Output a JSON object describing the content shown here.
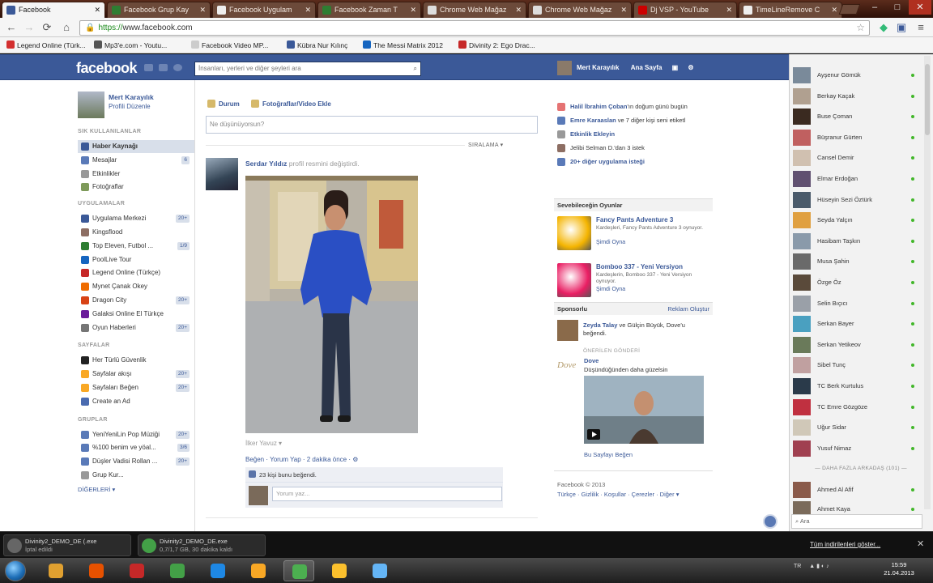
{
  "browser": {
    "tabs": [
      {
        "title": "Facebook",
        "active": true,
        "color": "#3b5998"
      },
      {
        "title": "Facebook Grup Kay",
        "color": "#2e7d32"
      },
      {
        "title": "Facebook Uygulam",
        "color": "#eeeeee"
      },
      {
        "title": "Facebook Zaman T",
        "color": "#2e7d32"
      },
      {
        "title": "Chrome Web Mağaz",
        "color": "#dddddd"
      },
      {
        "title": "Chrome Web Mağaz",
        "color": "#dddddd"
      },
      {
        "title": "Dj VSP - YouTube",
        "color": "#cc0000"
      },
      {
        "title": "TimeLineRemove C",
        "color": "#eeeeee"
      }
    ],
    "url_scheme": "https://",
    "url_host": "www.facebook.com",
    "bookmarks": [
      {
        "label": "Legend Online (Türk...",
        "color": "#d32f2f"
      },
      {
        "label": "Mp3'e.com - Youtu...",
        "color": "#555555"
      },
      {
        "label": "Facebook Video MP...",
        "color": "#cccccc"
      },
      {
        "label": "Kübra Nur Kılınç",
        "color": "#3b5998"
      },
      {
        "label": "The Messi Matrix 2012",
        "color": "#1565c0"
      },
      {
        "label": "Divinity 2: Ego Drac...",
        "color": "#c62828"
      }
    ]
  },
  "fb": {
    "logo": "facebook",
    "search_placeholder": "İnsanları, yerleri ve diğer şeyleri ara",
    "user_name": "Mert Karayılık",
    "home_label": "Ana Sayfa",
    "left": {
      "profile_name": "Mert Karayılık",
      "edit_profile": "Profili Düzenle",
      "favorites_header": "SIK KULLANILANLAR",
      "favorites": [
        {
          "label": "Haber Kaynağı",
          "selected": true,
          "color": "#3b5998"
        },
        {
          "label": "Mesajlar",
          "count": "6",
          "color": "#5a7ab8"
        },
        {
          "label": "Etkinlikler",
          "color": "#999999"
        },
        {
          "label": "Fotoğraflar",
          "color": "#7e9a5a"
        }
      ],
      "apps_header": "UYGULAMALAR",
      "apps": [
        {
          "label": "Uygulama Merkezi",
          "count": "20+",
          "color": "#3b5998"
        },
        {
          "label": "Kingsflood",
          "color": "#8d6e63"
        },
        {
          "label": "Top Eleven, Futbol ...",
          "count": "1/9",
          "color": "#2e7d32"
        },
        {
          "label": "PoolLive Tour",
          "color": "#1565c0"
        },
        {
          "label": "Legend Online (Türkçe)",
          "color": "#c62828"
        },
        {
          "label": "Mynet Çanak Okey",
          "color": "#ef6c00"
        },
        {
          "label": "Dragon City",
          "count": "20+",
          "color": "#d84315"
        },
        {
          "label": "Galaksi Online El Türkçe",
          "color": "#6a1b9a"
        },
        {
          "label": "Oyun Haberleri",
          "count": "20+",
          "color": "#757575"
        }
      ],
      "pages_header": "SAYFALAR",
      "pages": [
        {
          "label": "Her Türlü Güvenlik",
          "color": "#222222"
        },
        {
          "label": "Sayfalar akışı",
          "count": "20+",
          "color": "#f9a825"
        },
        {
          "label": "Sayfaları Beğen",
          "count": "20+",
          "color": "#f9a825"
        },
        {
          "label": "Create an Ad",
          "color": "#4a6bb0"
        }
      ],
      "groups_header": "GRUPLAR",
      "groups": [
        {
          "label": "YeniYeniLin Pop Müziği",
          "count": "20+",
          "color": "#5a7ab8"
        },
        {
          "label": "%100 benim ve yöal...",
          "count": "3/6",
          "color": "#5a7ab8"
        },
        {
          "label": "Düşler Vadisi Rollan ...",
          "count": "20+",
          "color": "#5a7ab8"
        },
        {
          "label": "Grup Kur...",
          "color": "#999999"
        }
      ],
      "more": "DİĞERLERİ ▾"
    },
    "composer": {
      "tab_status": "Durum",
      "tab_photo": "Fotoğraflar/Video Ekle",
      "placeholder": "Ne düşünüyorsun?",
      "sort": "SIRALAMA ▾"
    },
    "post": {
      "author": "Serdar Yıldız",
      "action": "profil resmini değiştirdi.",
      "tag_label": "İlker Yavuz ▾",
      "actions": "Beğen · Yorum Yap · 2 dakika önce · ⚙",
      "likes": "23 kişi bunu beğendi.",
      "comment_placeholder": "Yorum yaz..."
    },
    "right": {
      "ticker": [
        {
          "bold": "Halil İbrahim Çoban",
          "text": "'ın doğum günü bugün",
          "color": "#e57373"
        },
        {
          "bold": "Emre Karaaslan",
          "text": " ve 7 diğer kişi seni etiketl",
          "color": "#5a7ab8"
        },
        {
          "bold": "Etkinlik Ekleyin",
          "text": "",
          "color": "#999999"
        },
        {
          "bold": "",
          "text": "Jelibi Selman D.'dan 3 istek",
          "color": "#8d6e63"
        },
        {
          "bold": "20+ diğer uygulama isteği",
          "text": "",
          "color": "#5a7ab8"
        }
      ],
      "games_header": "Sevebileceğin Oyunlar",
      "games": [
        {
          "title": "Fancy Pants Adventure 3",
          "desc": "Kardeşleri, Fancy Pants Adventure 3 oynuyor.",
          "play": "Şimdi Oyna",
          "color": "#f4b400"
        },
        {
          "title": "Bomboo 337 - Yeni Versiyon",
          "desc": "Kardeşlerin, Bomboo 337 - Yeni Versiyon oynuyor.",
          "play": "Şimdi Oyna",
          "color": "#e91e63"
        }
      ],
      "sponsored_header": "Sponsorlu",
      "create_ad": "Reklam Oluştur",
      "sponsor_text_b": "Zeyda Talay",
      "sponsor_text": " ve Gülçin Büyük, Dove'u beğendi.",
      "suggested": "ÖNERİLEN GÖNDERİ",
      "dove_logo": "Dove",
      "dove_name": "Dove",
      "dove_caption": "Düşündüğünden daha güzelsin",
      "dove_like": "Bu Sayfayı Beğen",
      "footer1": "Facebook © 2013",
      "footer2": "Türkçe · Gizlilik · Koşullar · Çerezler · Diğer ▾"
    }
  },
  "chat": {
    "friends": [
      {
        "name": "Ayşenur Gömük",
        "color": "#7a8a9a"
      },
      {
        "name": "Berkay Kaçak",
        "color": "#b0a090"
      },
      {
        "name": "Buse Çoman",
        "color": "#3a2a20"
      },
      {
        "name": "Büşranur Gürten",
        "color": "#c06060"
      },
      {
        "name": "Cansel Demir",
        "color": "#d0c0b0"
      },
      {
        "name": "Elmar Erdoğan",
        "color": "#605070"
      },
      {
        "name": "Hüseyin Sezi Öztürk",
        "color": "#4a5a6a"
      },
      {
        "name": "Seyda Yalçın",
        "color": "#e0a040"
      },
      {
        "name": "Hasibam Taşkın",
        "color": "#8a9aaa"
      },
      {
        "name": "Musa Şahin",
        "color": "#6a6a6a"
      },
      {
        "name": "Özge Öz",
        "color": "#5a4a3a"
      },
      {
        "name": "Selin Bıçıcı",
        "color": "#9aa0a8"
      },
      {
        "name": "Serkan Bayer",
        "color": "#4aa0c0"
      },
      {
        "name": "Serkan Yetikeov",
        "color": "#6a7a5a"
      },
      {
        "name": "Sibel Tunç",
        "color": "#c0a0a0"
      },
      {
        "name": "TC Berk Kurtulus",
        "color": "#2a3a4a"
      },
      {
        "name": "TC Emre Gözgöze",
        "color": "#c03040"
      },
      {
        "name": "Uğur Sidar",
        "color": "#d0c8b8"
      },
      {
        "name": "Yusuf Nimaz",
        "color": "#a04050"
      }
    ],
    "more_header": "DAHA FAZLA ARKADAŞ (101)",
    "more": [
      {
        "name": "Ahmed Al Afif",
        "color": "#8a5a4a"
      },
      {
        "name": "Ahmet Kaya",
        "color": "#7a6a5a"
      }
    ],
    "search": "Ara"
  },
  "downloads": [
    {
      "name": "Divinity2_DEMO_DE (.exe",
      "status": "İptal edildi",
      "color": "#666666"
    },
    {
      "name": "Divinity2_DEMO_DE.exe",
      "status": "0,7/1,7 GB, 30 dakika kaldı",
      "color": "#43a047"
    }
  ],
  "download_all": "Tüm indirilenleri göster...",
  "taskbar": {
    "apps": [
      {
        "name": "media-player-icon",
        "color": "#e0a030",
        "on": false
      },
      {
        "name": "firefox-icon",
        "color": "#e65100",
        "on": false
      },
      {
        "name": "firefox-alt-icon",
        "color": "#c62828",
        "on": false
      },
      {
        "name": "utorrent-icon",
        "color": "#43a047",
        "on": false
      },
      {
        "name": "ie-icon",
        "color": "#1e88e5",
        "on": false
      },
      {
        "name": "folder-icon",
        "color": "#f9a825",
        "on": false
      },
      {
        "name": "chrome-icon",
        "color": "#4caf50",
        "on": true
      },
      {
        "name": "pen-tool-icon",
        "color": "#fbc02d",
        "on": false
      },
      {
        "name": "window-app-icon",
        "color": "#64b5f6",
        "on": false
      }
    ],
    "lang": "TR",
    "time": "15:59",
    "date": "21.04.2013"
  }
}
